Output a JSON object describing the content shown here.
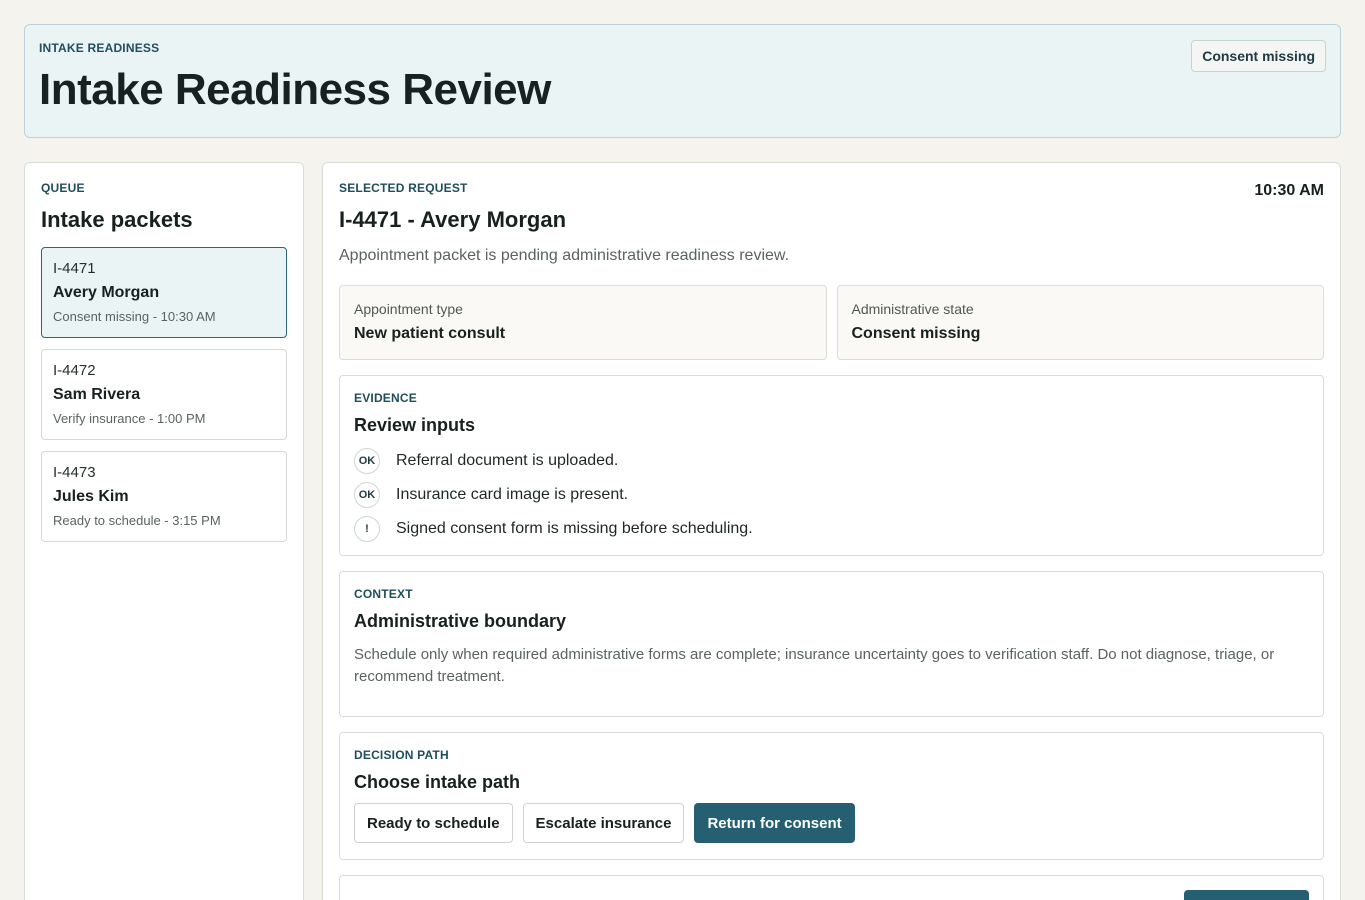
{
  "header": {
    "eyebrow": "INTAKE READINESS",
    "title": "Intake Readiness Review",
    "badge": "Consent missing"
  },
  "queue": {
    "eyebrow": "QUEUE",
    "title": "Intake packets",
    "items": [
      {
        "id": "I-4471",
        "name": "Avery Morgan",
        "status": "Consent missing - 10:30 AM"
      },
      {
        "id": "I-4472",
        "name": "Sam Rivera",
        "status": "Verify insurance - 1:00 PM"
      },
      {
        "id": "I-4473",
        "name": "Jules Kim",
        "status": "Ready to schedule - 3:15 PM"
      }
    ]
  },
  "request": {
    "eyebrow": "SELECTED REQUEST",
    "time": "10:30 AM",
    "title": "I-4471 - Avery Morgan",
    "summary": "Appointment packet is pending administrative readiness review.",
    "facts": [
      {
        "label": "Appointment type",
        "value": "New patient consult"
      },
      {
        "label": "Administrative state",
        "value": "Consent missing"
      }
    ]
  },
  "evidence": {
    "eyebrow": "EVIDENCE",
    "title": "Review inputs",
    "items": [
      {
        "badge": "OK",
        "text": "Referral document is uploaded."
      },
      {
        "badge": "OK",
        "text": "Insurance card image is present."
      },
      {
        "badge": "!",
        "text": "Signed consent form is missing before scheduling."
      }
    ]
  },
  "context": {
    "eyebrow": "CONTEXT",
    "title": "Administrative boundary",
    "body": "Schedule only when required administrative forms are complete; insurance uncertainty goes to verification staff. Do not diagnose, triage, or recommend treatment."
  },
  "decision": {
    "eyebrow": "DECISION PATH",
    "title": "Choose intake path",
    "actions": {
      "ready": "Ready to schedule",
      "escalate": "Escalate insurance",
      "return": "Return for consent"
    }
  },
  "colors": {
    "accent": "#265f72",
    "header_bg": "#eaf4f5",
    "page_bg": "#f4f3ee"
  }
}
